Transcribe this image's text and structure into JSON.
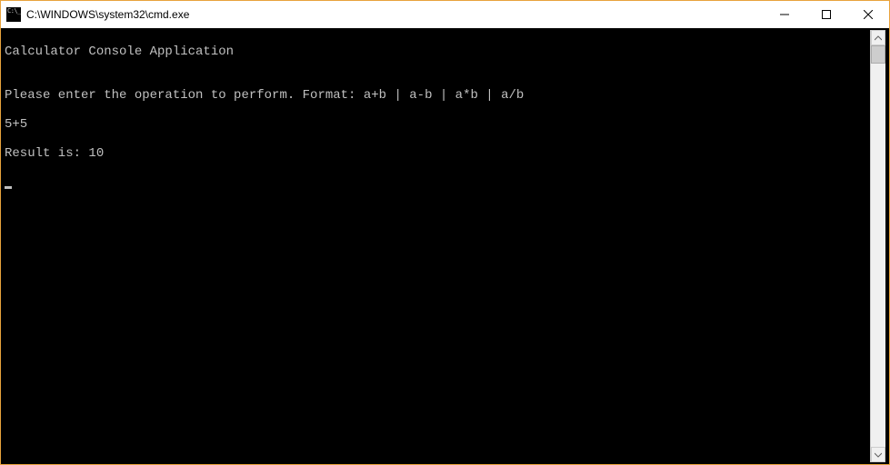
{
  "titlebar": {
    "title": "C:\\WINDOWS\\system32\\cmd.exe"
  },
  "console": {
    "lines": [
      "Calculator Console Application",
      "",
      "Please enter the operation to perform. Format: a+b | a-b | a*b | a/b",
      "5+5",
      "Result is: 10"
    ]
  }
}
